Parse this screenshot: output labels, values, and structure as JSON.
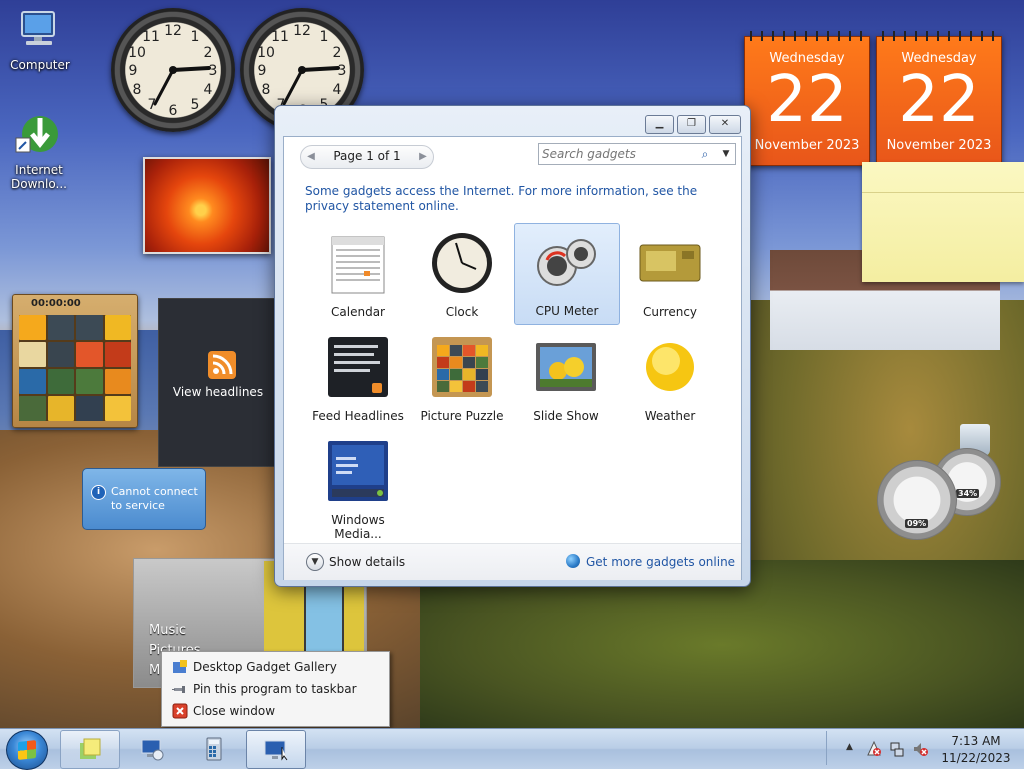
{
  "desktop": {
    "icons": [
      {
        "label": "Computer"
      },
      {
        "label_line1": "Internet",
        "label_line2": "Downlo..."
      }
    ],
    "calendars": [
      {
        "weekday": "Wednesday",
        "day": "22",
        "month_year": "November 2023"
      },
      {
        "weekday": "Wednesday",
        "day": "22",
        "month_year": "November 2023"
      }
    ],
    "puzzle": {
      "timer": "00:00:00"
    },
    "feed_gadget": {
      "text": "View headlines"
    },
    "weather_error": {
      "line1": "Cannot connect",
      "line2": "to service"
    },
    "media_center": {
      "items": [
        "Music",
        "Pictures",
        "M"
      ]
    },
    "cpu_meter": {
      "cpu_pct": "09%",
      "memory_pct": "34%"
    }
  },
  "gallery": {
    "pager": {
      "label": "Page 1 of 1"
    },
    "search": {
      "placeholder": "Search gadgets"
    },
    "info_text": "Some gadgets access the Internet.  For more information, see the privacy statement online.",
    "gadgets": [
      {
        "name": "Calendar",
        "icon": "calendar-icon"
      },
      {
        "name": "Clock",
        "icon": "clock-icon"
      },
      {
        "name": "CPU Meter",
        "icon": "cpu-meter-icon",
        "selected": true
      },
      {
        "name": "Currency",
        "icon": "currency-icon"
      },
      {
        "name": "Feed Headlines",
        "icon": "feed-headlines-icon"
      },
      {
        "name": "Picture Puzzle",
        "icon": "picture-puzzle-icon"
      },
      {
        "name": "Slide Show",
        "icon": "slide-show-icon"
      },
      {
        "name": "Weather",
        "icon": "weather-icon"
      },
      {
        "name": "Windows Media...",
        "icon": "windows-media-icon"
      }
    ],
    "footer": {
      "details": "Show details",
      "more": "Get more gadgets online"
    }
  },
  "context_menu": {
    "items": [
      {
        "label": "Desktop Gadget Gallery",
        "icon": "gadget-gallery-icon"
      },
      {
        "label": "Pin this program to taskbar",
        "icon": "pin-icon"
      },
      {
        "label": "Close window",
        "icon": "close-window-icon"
      }
    ]
  },
  "taskbar": {
    "clock": {
      "time": "7:13 AM",
      "date": "11/22/2023"
    }
  },
  "colors": {
    "accent_link": "#2156a4",
    "calendar_orange": "#e8561a",
    "selection": "#c8dcf5"
  }
}
